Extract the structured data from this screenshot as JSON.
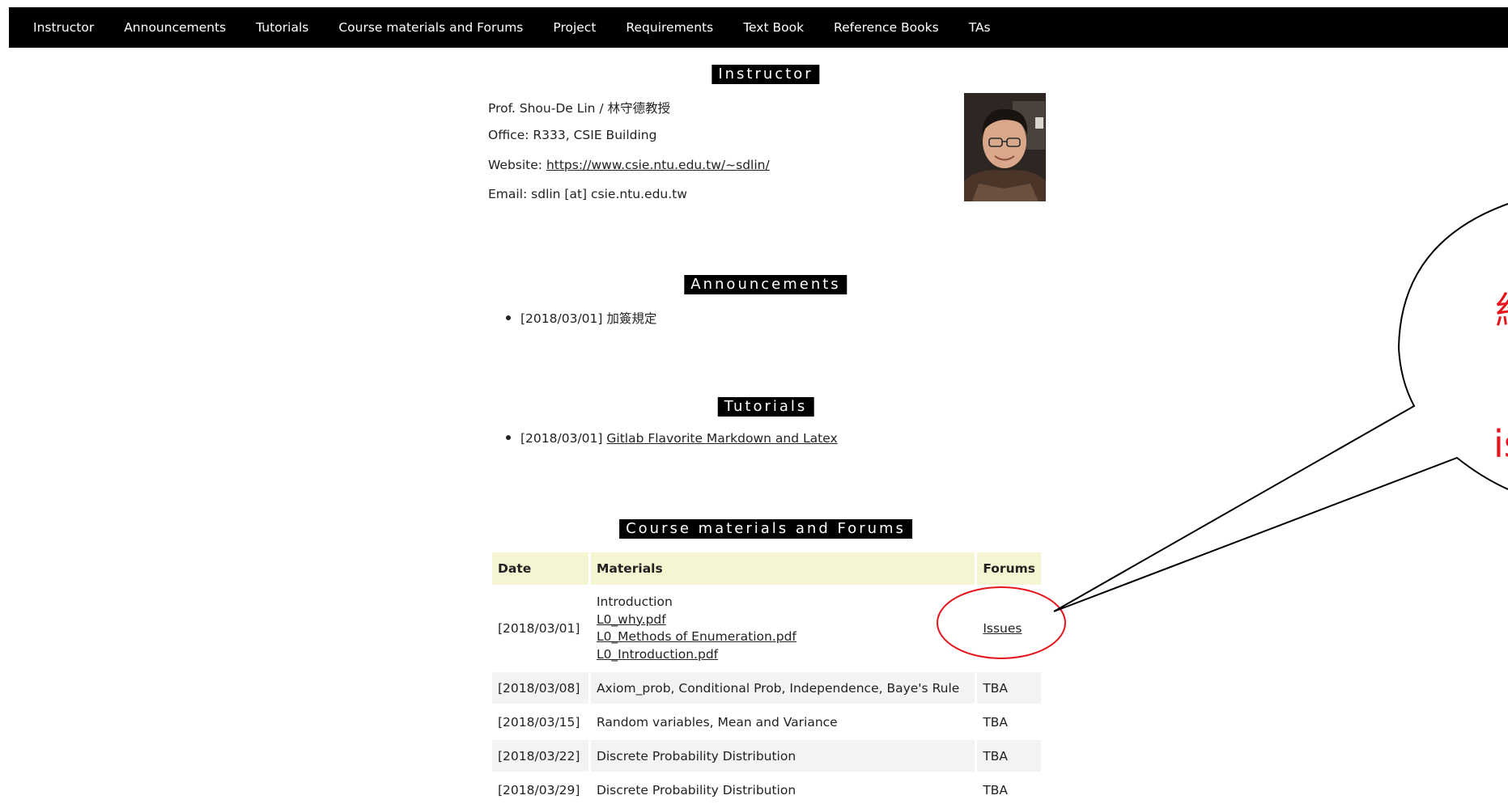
{
  "nav": {
    "items": [
      "Instructor",
      "Announcements",
      "Tutorials",
      "Course materials and Forums",
      "Project",
      "Requirements",
      "Text Book",
      "Reference Books",
      "TAs"
    ]
  },
  "instructor": {
    "heading": "Instructor",
    "name": "Prof. Shou-De Lin / 林守德教授",
    "office": "Office: R333, CSIE Building",
    "website_label": "Website: ",
    "website_url": "https://www.csie.ntu.edu.tw/~sdlin/",
    "email": "Email: sdlin [at] csie.ntu.edu.tw"
  },
  "announcements": {
    "heading": "Announcements",
    "items": [
      {
        "date": "[2018/03/01]",
        "text": "加簽規定"
      }
    ]
  },
  "tutorials": {
    "heading": "Tutorials",
    "items": [
      {
        "date": "[2018/03/01]",
        "link": "Gitlab Flavorite Markdown and Latex"
      }
    ]
  },
  "course": {
    "heading": "Course materials and Forums",
    "columns": [
      "Date",
      "Materials",
      "Forums"
    ],
    "rows": [
      {
        "date": "[2018/03/01]",
        "title": "Introduction",
        "files": [
          "L0_why.pdf",
          "L0_Methods of Enumeration.pdf",
          "L0_Introduction.pdf"
        ],
        "forum": "Issues"
      },
      {
        "date": "[2018/03/08]",
        "material": "Axiom_prob, Conditional Prob, Independence, Baye's Rule",
        "forum": "TBA"
      },
      {
        "date": "[2018/03/15]",
        "material": "Random variables, Mean and Variance",
        "forum": "TBA"
      },
      {
        "date": "[2018/03/22]",
        "material": "Discrete Probability Distribution",
        "forum": "TBA"
      },
      {
        "date": "[2018/03/29]",
        "material": "Discrete Probability Distribution",
        "forum": "TBA"
      }
    ]
  },
  "callout": {
    "text_top": "約",
    "text_bottom": "is",
    "color": "#e8141b"
  }
}
